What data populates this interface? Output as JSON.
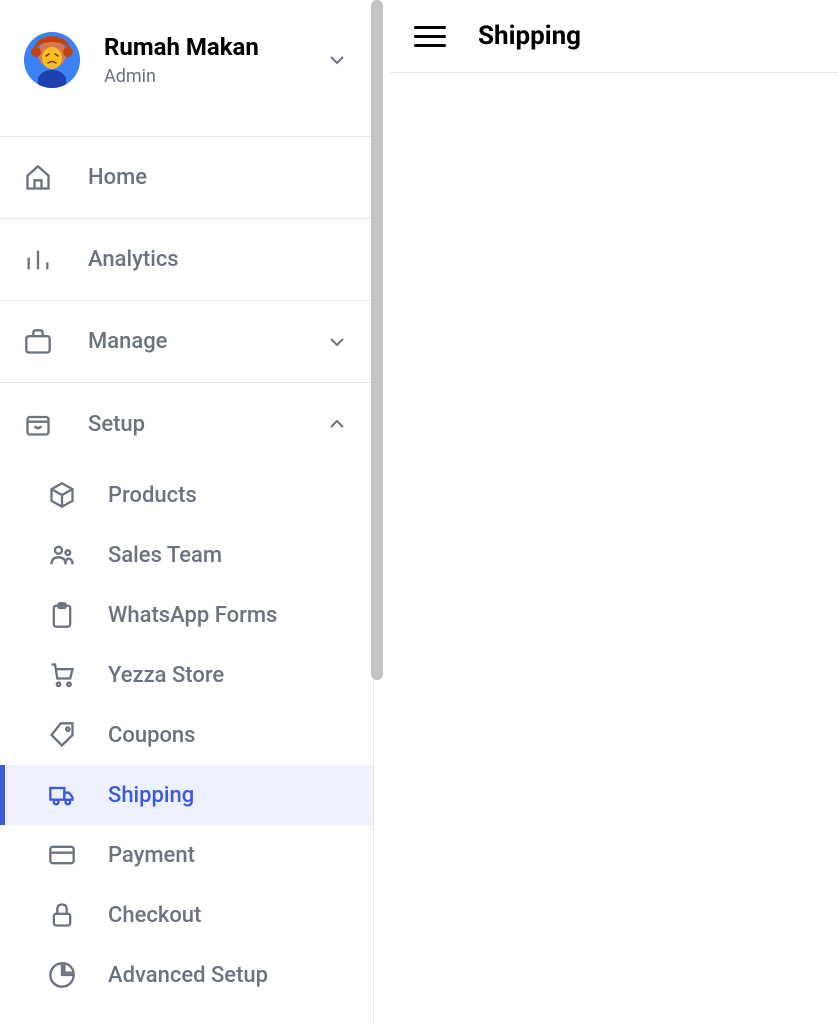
{
  "profile": {
    "name": "Rumah Makan",
    "role": "Admin"
  },
  "nav": {
    "home": "Home",
    "analytics": "Analytics",
    "manage": "Manage",
    "setup": "Setup"
  },
  "setup_items": {
    "products": "Products",
    "sales_team": "Sales Team",
    "whatsapp_forms": "WhatsApp Forms",
    "yezza_store": "Yezza Store",
    "coupons": "Coupons",
    "shipping": "Shipping",
    "payment": "Payment",
    "checkout": "Checkout",
    "advanced_setup": "Advanced Setup"
  },
  "header": {
    "title": "Shipping"
  }
}
